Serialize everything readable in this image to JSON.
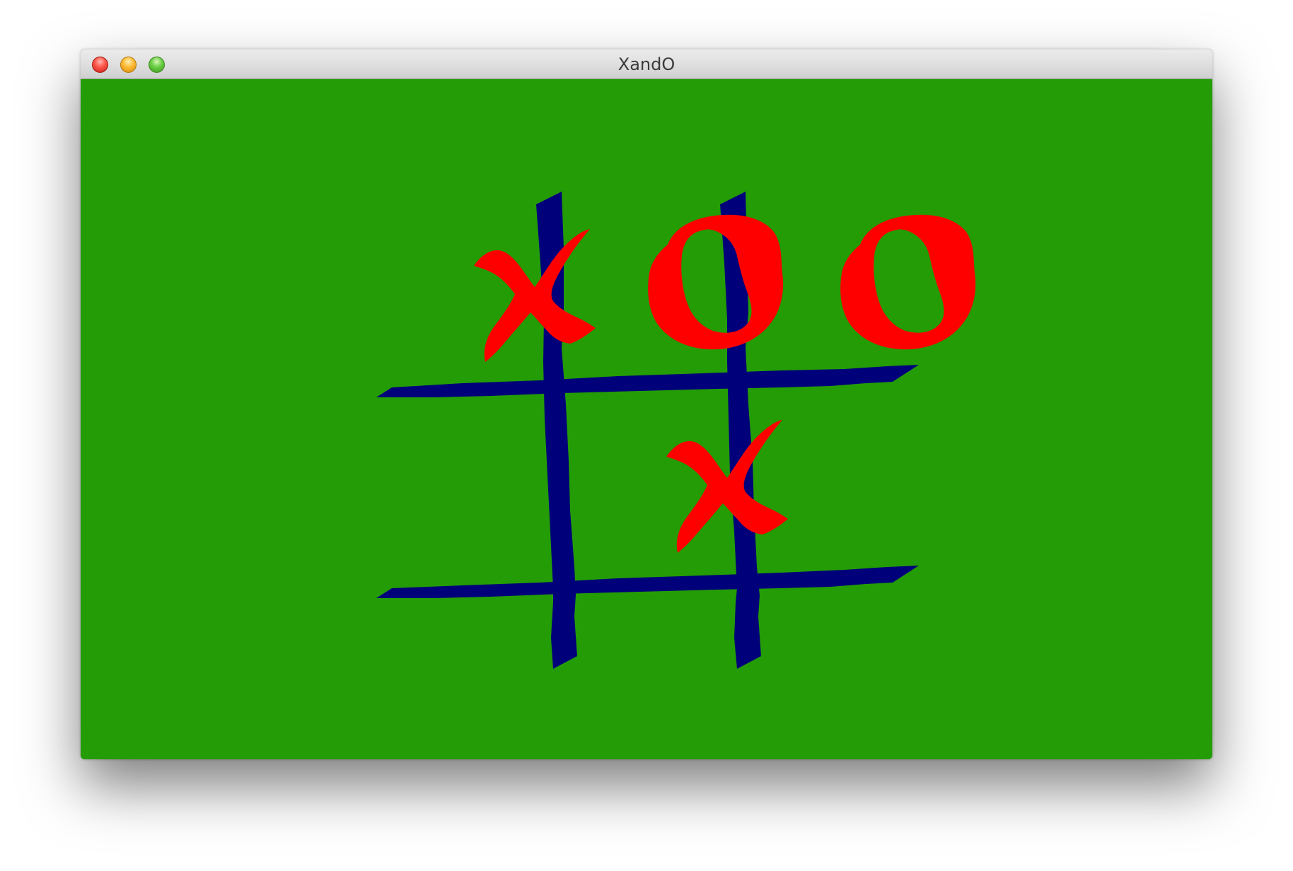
{
  "window": {
    "title": "XandO"
  },
  "colors": {
    "background": "#249c05",
    "grid": "#00007a",
    "mark": "#ff0000"
  },
  "board": [
    [
      "X",
      "O",
      "O"
    ],
    [
      "",
      "X",
      ""
    ],
    [
      "",
      "",
      ""
    ]
  ]
}
